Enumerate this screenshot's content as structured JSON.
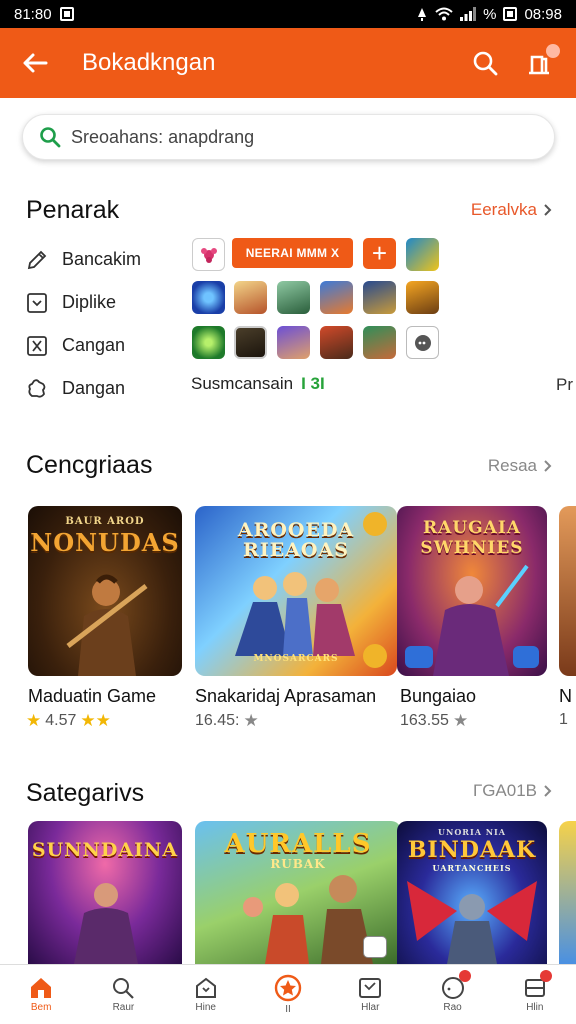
{
  "status": {
    "time_left": "81:80",
    "time_right": "08:98",
    "battery": "%"
  },
  "appbar": {
    "title": "Bokadkngan",
    "back_icon": "arrow-left-icon",
    "colors": {
      "brand": "#ef5a17"
    }
  },
  "search": {
    "placeholder": "Sreoahans: anapdrang"
  },
  "penarak": {
    "title": "Penarak",
    "link": "Eeralvka",
    "categories": [
      {
        "label": "Bancakim",
        "icon": "pencil-icon"
      },
      {
        "label": "Diplike",
        "icon": "chevron-box-icon"
      },
      {
        "label": "Cangan",
        "icon": "x-box-icon"
      },
      {
        "label": "Dangan",
        "icon": "puzzle-icon"
      }
    ],
    "chip_label": "NEERAI MMM X",
    "footer_text": "Susmcansain",
    "footer_green": "I 3I",
    "edge_text": "Pr"
  },
  "cencgriaas": {
    "title": "Cencgriaas",
    "link": "Resaa",
    "cards": [
      {
        "title": "Maduatin Game",
        "rating": "4.57",
        "cover": "NONUDAS",
        "cover_top": "BAUR AROD"
      },
      {
        "title": "Snakaridaj Aprasaman",
        "rating": "16.45:",
        "cover": "AROOEDA RIEAOAS",
        "cover_bottom": "MNOSARCARS"
      },
      {
        "title": "Bungaiao",
        "rating": "163.55",
        "cover": "RAUGAIA SWHNIES"
      },
      {
        "title": "N",
        "rating": "1"
      }
    ]
  },
  "sategarivs": {
    "title": "Sategarivs",
    "link": "ГGA01B",
    "cards": [
      {
        "cover": "SUNNDAINA"
      },
      {
        "cover": "AURALLS",
        "cover_sub": "RUBAK"
      },
      {
        "cover": "BINDAAK",
        "cover_top": "UNORIA NIA",
        "cover_sub": "UARTANCHEIS"
      }
    ]
  },
  "bottom_nav": [
    {
      "label": "Bem",
      "icon": "home-icon",
      "active": true
    },
    {
      "label": "Raur",
      "icon": "search-icon"
    },
    {
      "label": "Hine",
      "icon": "house-outline-icon"
    },
    {
      "label": "II",
      "icon": "star-circle-icon"
    },
    {
      "label": "Hlar",
      "icon": "book-icon"
    },
    {
      "label": "Rao",
      "icon": "chat-icon"
    },
    {
      "label": "Hlin",
      "icon": "inbox-icon"
    }
  ]
}
